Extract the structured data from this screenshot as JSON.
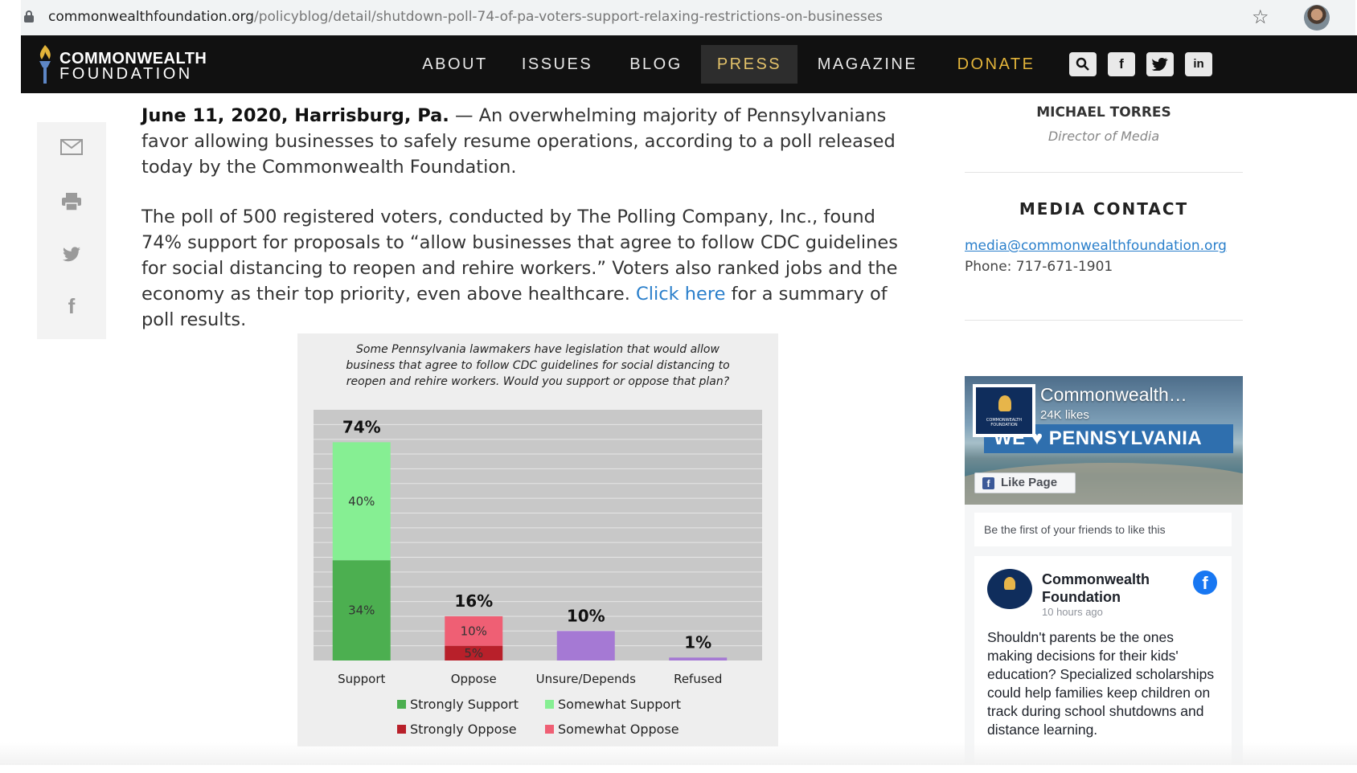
{
  "browser": {
    "url_host": "commonwealthfoundation.org",
    "url_path": "/policyblog/detail/shutdown-poll-74-of-pa-voters-support-relaxing-restrictions-on-businesses"
  },
  "site": {
    "logo_line1": "COMMONWEALTH",
    "logo_line2": "FOUNDATION",
    "nav": [
      "ABOUT",
      "ISSUES",
      "BLOG",
      "PRESS",
      "MAGAZINE",
      "DONATE"
    ],
    "active_nav": "PRESS",
    "social": {
      "facebook": "f",
      "twitter": "t",
      "linkedin": "in"
    },
    "colors": {
      "nav_bg": "#111111",
      "active_gold": "#e3c26a",
      "donate_gold": "#e3b43a",
      "link": "#2a7fcb"
    }
  },
  "share_icons": [
    "email-icon",
    "print-icon",
    "twitter-icon",
    "facebook-icon"
  ],
  "article": {
    "p1_lead": "June 11, 2020, Harrisburg, Pa.",
    "p1_rest": " — An overwhelming majority of Pennsylvanians favor allowing businesses to safely resume operations, according to a poll released today by the Commonwealth Foundation.",
    "p2_before": "The poll of 500 registered voters, conducted by The Polling Company, Inc., found 74% support for proposals to “allow businesses that agree to follow CDC guidelines for social distancing to reopen and rehire workers.” Voters also ranked jobs and the economy as their top priority, even above healthcare. ",
    "p2_link": "Click here",
    "p2_after": " for a summary of poll results."
  },
  "chart_data": {
    "type": "bar",
    "title": "Some Pennsylvania lawmakers have legislation that would allow business that agree to follow CDC guidelines for social distancing to reopen and rehire workers. Would you support or oppose that plan?",
    "categories": [
      "Support",
      "Oppose",
      "Unsure/Depends",
      "Refused"
    ],
    "totals": [
      "74%",
      "16%",
      "10%",
      "1%"
    ],
    "series": [
      {
        "name": "Strongly Support",
        "values": [
          34,
          0,
          0,
          0
        ],
        "color": "#4caf50",
        "labels": [
          "34%",
          "",
          "",
          ""
        ]
      },
      {
        "name": "Somewhat Support",
        "values": [
          40,
          0,
          0,
          0
        ],
        "color": "#86ef93",
        "labels": [
          "40%",
          "",
          "",
          ""
        ]
      },
      {
        "name": "Strongly Oppose",
        "values": [
          0,
          5,
          0,
          0
        ],
        "color": "#b8202a",
        "labels": [
          "",
          "5%",
          "",
          ""
        ]
      },
      {
        "name": "Somewhat Oppose",
        "values": [
          0,
          10,
          0,
          0
        ],
        "color": "#ef5f74",
        "labels": [
          "",
          "10%",
          "",
          ""
        ]
      },
      {
        "values": [
          0,
          0,
          10,
          1
        ],
        "color": "#a579d4",
        "labels": [
          "",
          "",
          "",
          ""
        ]
      }
    ],
    "legend": [
      "Strongly Support",
      "Somewhat Support",
      "Strongly Oppose",
      "Somewhat Oppose"
    ],
    "ylim": [
      0,
      85
    ],
    "grid": true,
    "legend_position": "bottom"
  },
  "sidebar": {
    "name": "MICHAEL TORRES",
    "role": "Director of Media",
    "media_heading": "MEDIA CONTACT",
    "email": "media@commonwealthfoundation.org",
    "phone": "Phone: 717-671-1901"
  },
  "fb": {
    "page_name": "Commonwealth…",
    "likes": "24K likes",
    "banner": "WE ♥ PENNSYLVANIA",
    "like_button": "Like Page",
    "friends": "Be the first of your friends to like this",
    "post_name": "Commonwealth Foundation",
    "post_time": "10 hours ago",
    "post_text": "Shouldn't parents be the ones making decisions for their kids' education? Specialized scholarships could help families keep children on track during school shutdowns and distance learning.",
    "logo_text": "COMMONWEALTH FOUNDATION"
  }
}
